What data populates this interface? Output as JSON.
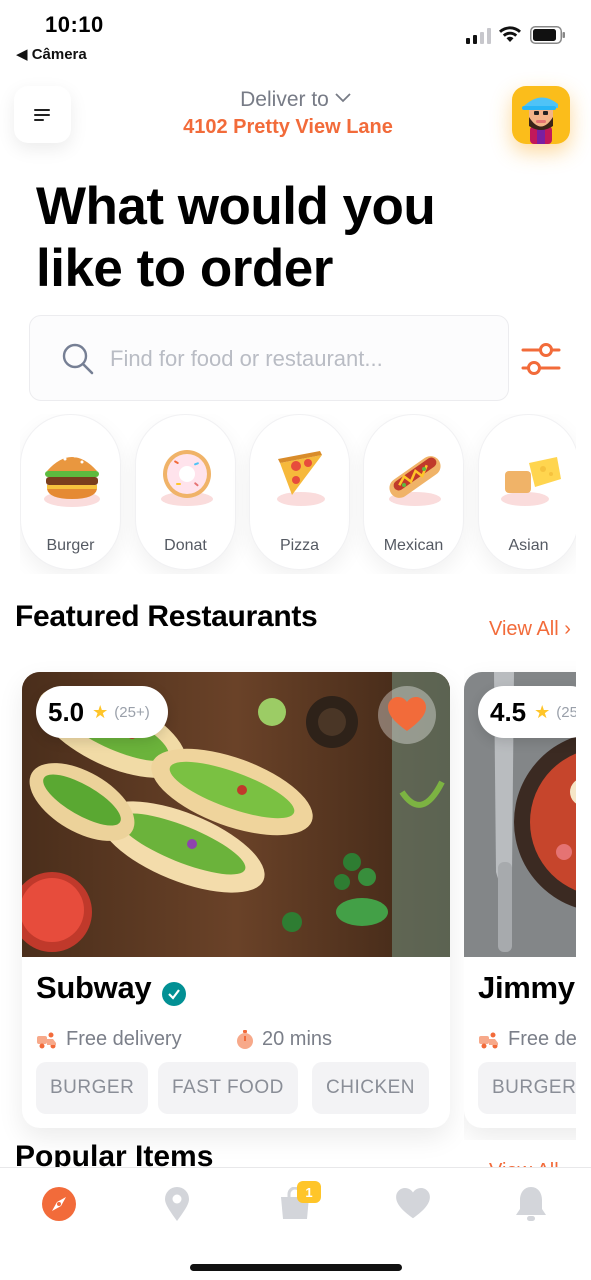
{
  "status_bar": {
    "time": "10:10",
    "back_app": "◀ Câmera"
  },
  "header": {
    "deliver_label": "Deliver to",
    "address": "4102 Pretty View Lane"
  },
  "headline": "What would you like to order",
  "search": {
    "placeholder": "Find for food or restaurant..."
  },
  "categories": [
    {
      "label": "Burger",
      "icon": "burger-icon"
    },
    {
      "label": "Donat",
      "icon": "donut-icon"
    },
    {
      "label": "Pizza",
      "icon": "pizza-icon"
    },
    {
      "label": "Mexican",
      "icon": "hotdog-icon"
    },
    {
      "label": "Asian",
      "icon": "asian-food-icon"
    }
  ],
  "featured": {
    "title": "Featured Restaurants",
    "view_all": "View All",
    "restaurants": [
      {
        "rating": "5.0",
        "rating_count": "(25+)",
        "name": "Subway",
        "verified": true,
        "favorite": true,
        "delivery": "Free delivery",
        "time": "20 mins",
        "tags": [
          "BURGER",
          "FAST FOOD",
          "CHICKEN"
        ]
      },
      {
        "rating": "4.5",
        "rating_count": "(25",
        "name": "Jimmy",
        "delivery": "Free del",
        "tags": [
          "BURGER"
        ]
      }
    ]
  },
  "popular": {
    "title": "Popular Items",
    "view_all": "View All"
  },
  "tabbar": {
    "items": [
      "explore-icon",
      "location-icon",
      "cart-icon",
      "favorites-icon",
      "notifications-icon"
    ],
    "cart_badge": "1",
    "active": "explore-icon"
  },
  "colors": {
    "accent": "#f26b3a",
    "star": "#ffc529",
    "verified": "#029094",
    "avatar_bg": "#fbbd1b"
  }
}
